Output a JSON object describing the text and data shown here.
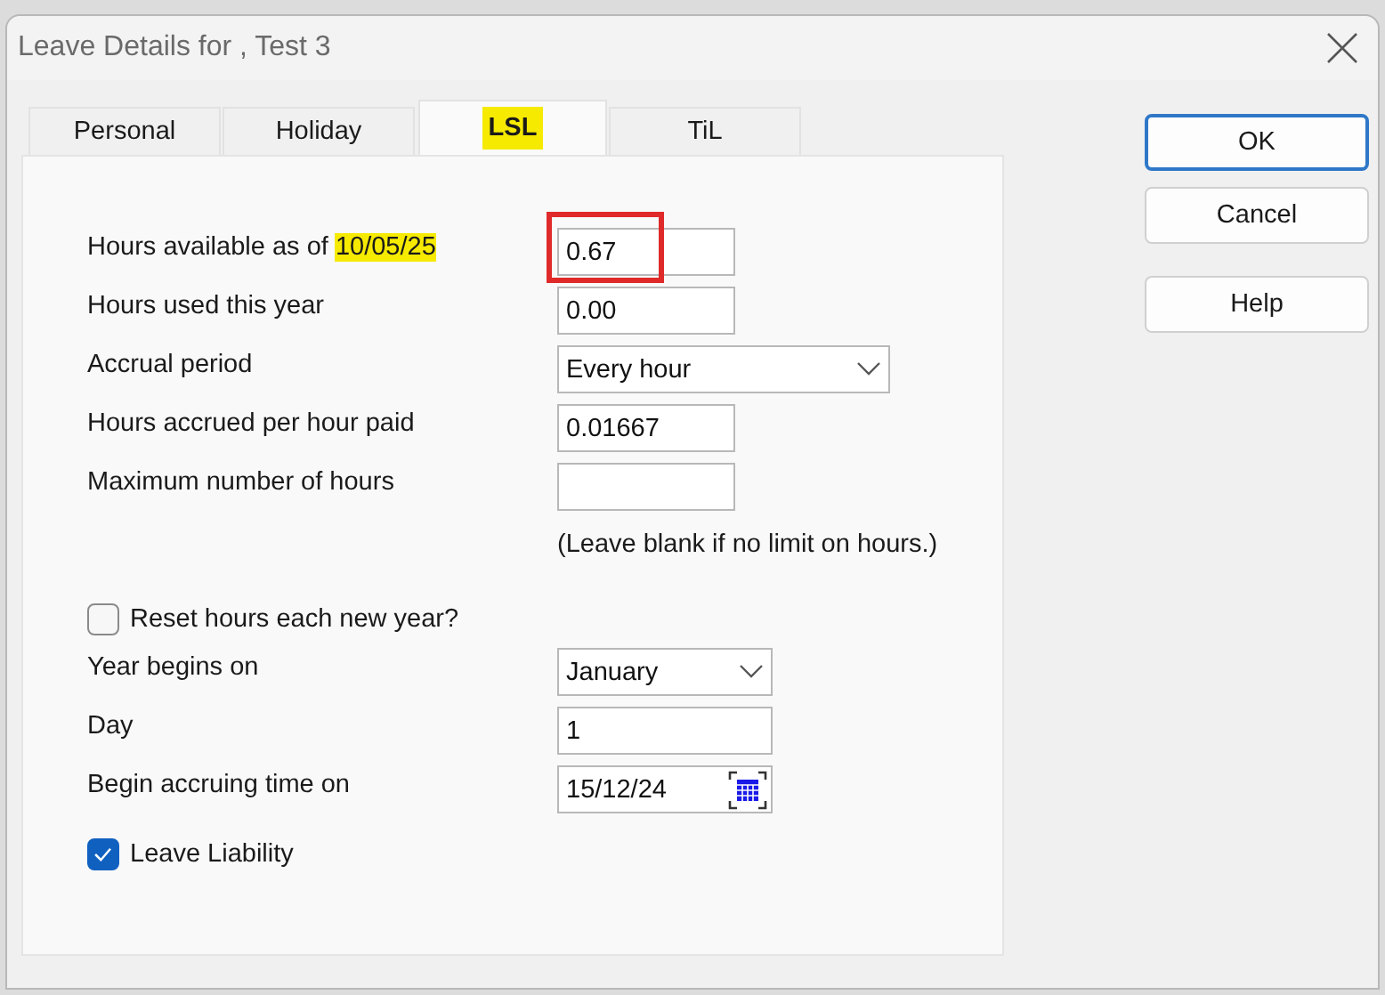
{
  "window": {
    "title": "Leave Details for , Test 3"
  },
  "tabs": [
    {
      "label": "Personal",
      "selected": false,
      "highlighted": false
    },
    {
      "label": "Holiday",
      "selected": false,
      "highlighted": false
    },
    {
      "label": "LSL",
      "selected": true,
      "highlighted": true
    },
    {
      "label": "TiL",
      "selected": false,
      "highlighted": false
    }
  ],
  "fields": [
    {
      "kind": "text",
      "label": "Hours available as of ",
      "label_date": "10/05/25",
      "date_highlighted": true,
      "value": "0.67",
      "circled": true
    },
    {
      "kind": "text",
      "label": "Hours used this year",
      "value": "0.00",
      "circled": false
    },
    {
      "kind": "combo",
      "label": "Accrual period",
      "value": "Every hour"
    },
    {
      "kind": "text",
      "label": "Hours accrued per hour paid",
      "value": "0.01667",
      "circled": false
    },
    {
      "kind": "text",
      "label": "Maximum number of hours",
      "circled": false
    },
    {
      "kind": "note",
      "label": "(Leave blank if no limit on hours.)"
    },
    {
      "kind": "checkbox",
      "label": "Reset hours each new year?",
      "checked": false
    },
    {
      "kind": "shortcombo",
      "label": "Year begins on",
      "value": "January"
    },
    {
      "kind": "shorttext",
      "label": "Day",
      "value": "1"
    },
    {
      "kind": "date",
      "label": "Begin accruing time on",
      "value": "15/12/24"
    },
    {
      "kind": "checkbox",
      "label": "Leave Liability",
      "checked": true
    }
  ],
  "buttons": [
    {
      "label": "OK",
      "default": true
    },
    {
      "label": "Cancel",
      "default": false
    },
    {
      "label": "Help",
      "default": false
    }
  ]
}
